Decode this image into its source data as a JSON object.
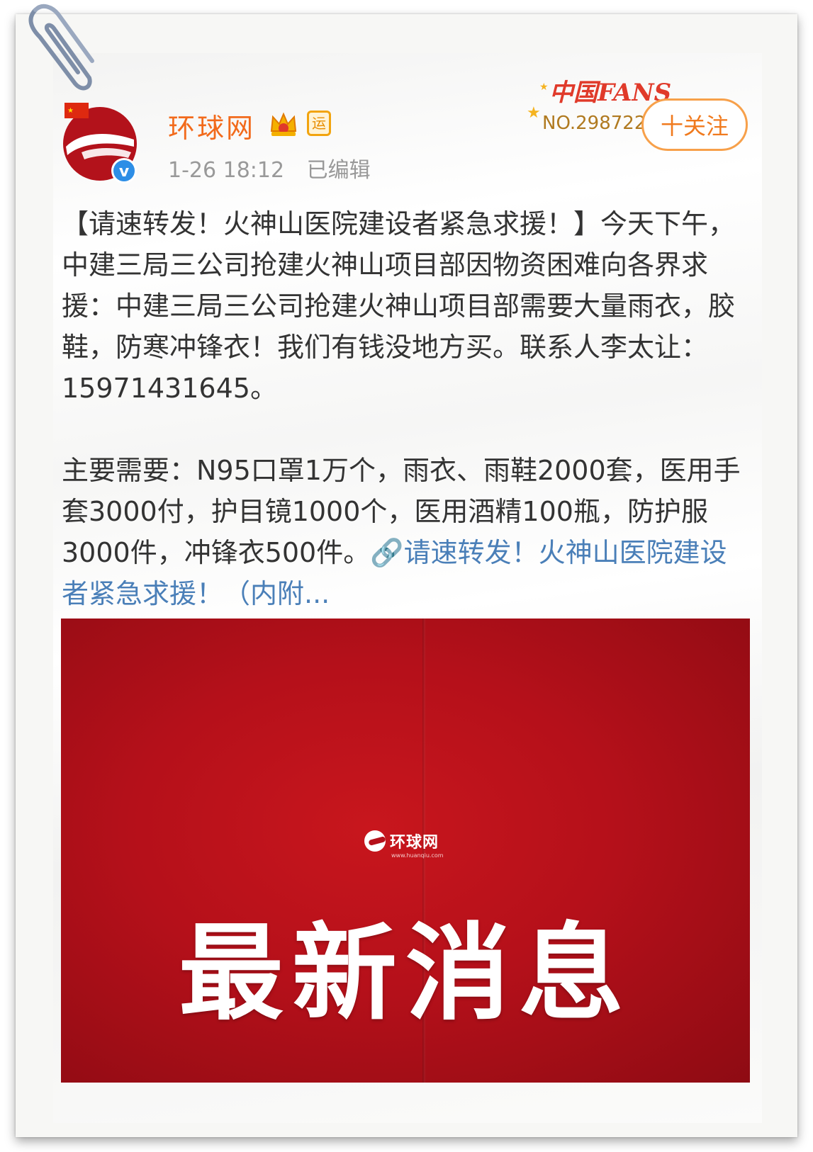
{
  "post": {
    "author": "环球网",
    "timestamp": "1-26 18:12",
    "edited_label": "已编辑",
    "yun_badge": "运",
    "follow_label": "十关注",
    "fans_badge": {
      "logo": "中国FANS",
      "number": "NO.298722"
    },
    "paragraph1": "【请速转发！火神山医院建设者紧急求援！】今天下午，中建三局三公司抢建火神山项目部因物资困难向各界求援：中建三局三公司抢建火神山项目部需要大量雨衣，胶鞋，防寒冲锋衣！我们有钱没地方买。联系人李太让：15971431645。",
    "paragraph2": "主要需要：N95口罩1万个，雨衣、雨鞋2000套，医用手套3000付，护目镜1000个，医用酒精100瓶，防护服3000件，冲锋衣500件。",
    "link_text": "请速转发！火神山医院建设者紧急求援！（内附...",
    "image": {
      "logo_text": "环球网",
      "logo_subtext": "www.huanqiu.com",
      "headline": "最新消息"
    }
  },
  "colors": {
    "name": "#f26a1b",
    "link": "#4a7fb8",
    "image_red": "#b5101a",
    "verified": "#2d8ee6"
  },
  "icons": [
    "paperclip-icon",
    "china-flag-icon",
    "crown-vip-icon",
    "verified-icon",
    "link-icon"
  ]
}
